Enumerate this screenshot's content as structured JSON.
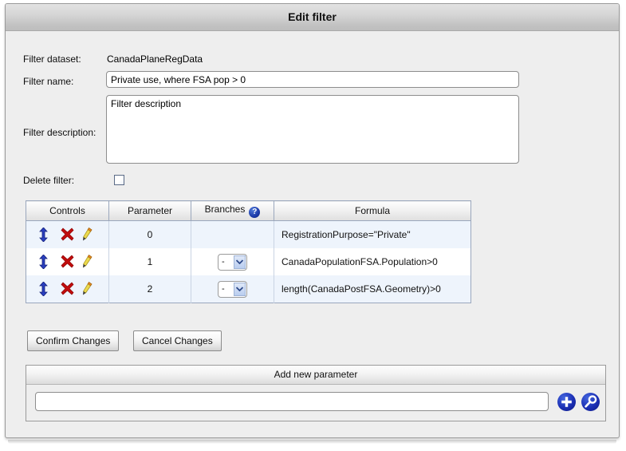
{
  "window": {
    "title": "Edit filter"
  },
  "form": {
    "dataset_label": "Filter dataset:",
    "dataset_value": "CanadaPlaneRegData",
    "name_label": "Filter name:",
    "name_value": "Private use, where FSA pop > 0",
    "name_placeholder": "",
    "description_label": "Filter description:",
    "description_value": "Filter description",
    "description_placeholder": "",
    "delete_label": "Delete filter:",
    "delete_checked": false
  },
  "table": {
    "headers": {
      "controls": "Controls",
      "parameter": "Parameter",
      "branches": "Branches",
      "branches_help": "?",
      "formula": "Formula"
    },
    "rows": [
      {
        "parameter": "0",
        "branch": "",
        "has_branch_select": false,
        "formula": "RegistrationPurpose=\"Private\""
      },
      {
        "parameter": "1",
        "branch": "-",
        "has_branch_select": true,
        "formula": "CanadaPopulationFSA.Population>0"
      },
      {
        "parameter": "2",
        "branch": "-",
        "has_branch_select": true,
        "formula": "length(CanadaPostFSA.Geometry)>0"
      }
    ]
  },
  "buttons": {
    "confirm": "Confirm Changes",
    "cancel": "Cancel Changes"
  },
  "add_parameter": {
    "header": "Add new parameter",
    "input_value": "",
    "input_placeholder": ""
  },
  "colors": {
    "accent_blue": "#1b2fb4",
    "help_blue": "#1b39a8",
    "delete_red": "#c00000",
    "arrow_blue": "#2a3fbf",
    "pencil_yellow": "#e8d64a",
    "row_alt": "#eef4fc",
    "table_border": "#9aa7bd"
  }
}
